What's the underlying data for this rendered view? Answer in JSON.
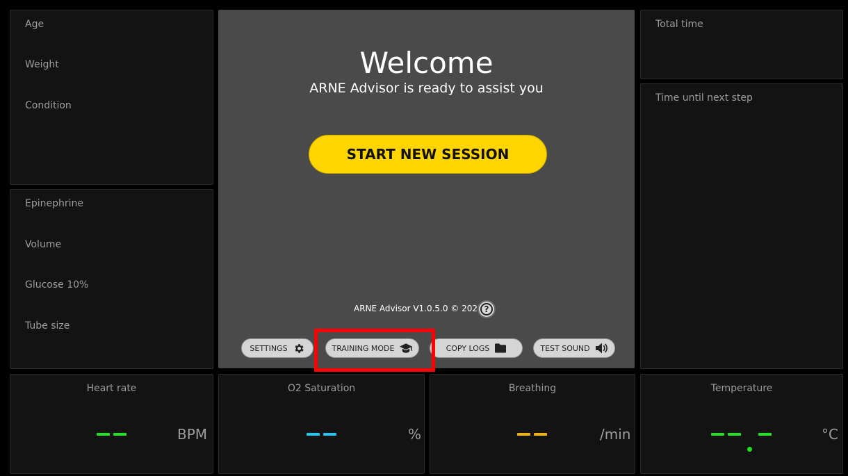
{
  "patient": {
    "age_label": "Age",
    "weight_label": "Weight",
    "condition_label": "Condition"
  },
  "medication": {
    "epinephrine_label": "Epinephrine",
    "volume_label": "Volume",
    "glucose_label": "Glucose 10%",
    "tube_size_label": "Tube size"
  },
  "timers": {
    "total_time_label": "Total time",
    "next_step_label": "Time until next step"
  },
  "welcome": {
    "title": "Welcome",
    "subtitle": "ARNE Advisor is ready to assist you",
    "start_button": "START NEW SESSION",
    "version": "ARNE Advisor V1.0.5.0 © 2022",
    "help_glyph": "?"
  },
  "actions": {
    "settings": "SETTINGS",
    "training_mode": "TRAINING MODE",
    "copy_logs": "COPY LOGS",
    "test_sound": "TEST SOUND"
  },
  "vitals": {
    "heart_rate": {
      "label": "Heart rate",
      "unit": "BPM",
      "color": "#22e022"
    },
    "o2": {
      "label": "O2 Saturation",
      "unit": "%",
      "color": "#1ec8f0"
    },
    "breathing": {
      "label": "Breathing",
      "unit": "/min",
      "color": "#f0b400"
    },
    "temperature": {
      "label": "Temperature",
      "unit": "°C",
      "color": "#22e022"
    }
  },
  "icons": {
    "settings": "gear-icon",
    "training_mode": "graduation-cap-icon",
    "copy_logs": "folder-icon",
    "test_sound": "speaker-icon",
    "help": "help-circle-icon"
  },
  "colors": {
    "accent": "#ffd500",
    "highlight": "#ff0000",
    "panel": "#131313",
    "center_panel": "#4a4a4a"
  }
}
